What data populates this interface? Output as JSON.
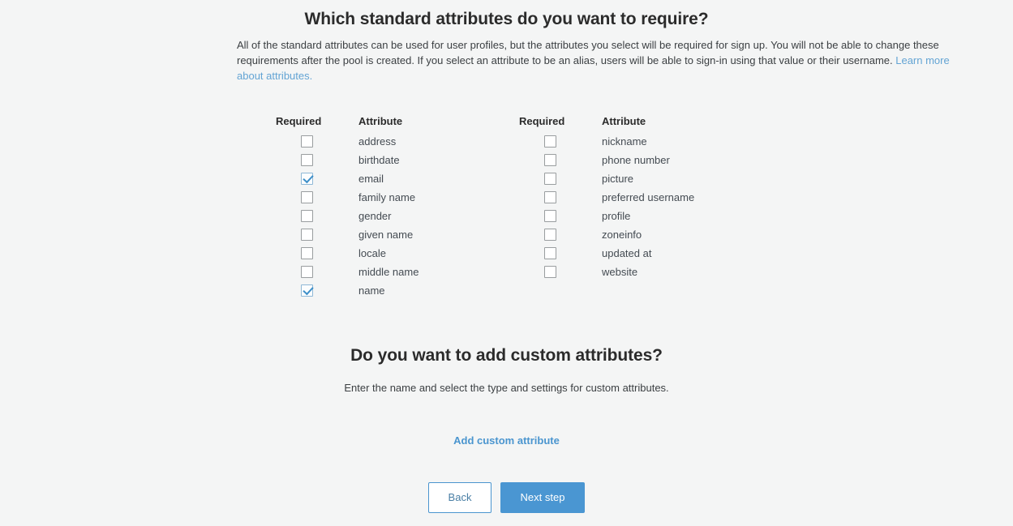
{
  "standard_section": {
    "heading": "Which standard attributes do you want to require?",
    "intro_text": "All of the standard attributes can be used for user profiles, but the attributes you select will be required for sign up. You will not be able to change these requirements after the pool is created. If you select an attribute to be an alias, users will be able to sign-in using that value or their username.",
    "learn_more_label": "Learn more about attributes.",
    "columns": [
      {
        "header_required": "Required",
        "header_attribute": "Attribute",
        "rows": [
          {
            "label": "address",
            "checked": false
          },
          {
            "label": "birthdate",
            "checked": false
          },
          {
            "label": "email",
            "checked": true
          },
          {
            "label": "family name",
            "checked": false
          },
          {
            "label": "gender",
            "checked": false
          },
          {
            "label": "given name",
            "checked": false
          },
          {
            "label": "locale",
            "checked": false
          },
          {
            "label": "middle name",
            "checked": false
          },
          {
            "label": "name",
            "checked": true
          }
        ]
      },
      {
        "header_required": "Required",
        "header_attribute": "Attribute",
        "rows": [
          {
            "label": "nickname",
            "checked": false
          },
          {
            "label": "phone number",
            "checked": false
          },
          {
            "label": "picture",
            "checked": false
          },
          {
            "label": "preferred username",
            "checked": false
          },
          {
            "label": "profile",
            "checked": false
          },
          {
            "label": "zoneinfo",
            "checked": false
          },
          {
            "label": "updated at",
            "checked": false
          },
          {
            "label": "website",
            "checked": false
          }
        ]
      }
    ]
  },
  "custom_section": {
    "heading": "Do you want to add custom attributes?",
    "subtitle": "Enter the name and select the type and settings for custom attributes.",
    "add_link_label": "Add custom attribute"
  },
  "footer": {
    "back_label": "Back",
    "next_label": "Next step"
  },
  "colors": {
    "page_background": "#f4f5f5",
    "heading_text": "#2b2b2b",
    "body_text": "#3c4043",
    "link_blue": "#63a4d4",
    "accent_blue": "#4a96d2",
    "checkbox_check": "#3d8fc9",
    "checkbox_border": "#999d9f"
  }
}
